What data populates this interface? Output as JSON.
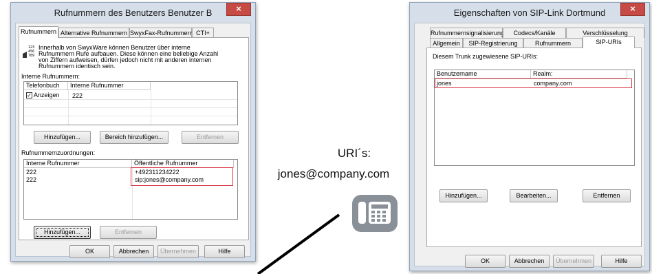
{
  "left_window": {
    "title": "Rufnummern des Benutzers Benutzer B",
    "close_label": "×",
    "tabs": [
      "Rufnummern",
      "Alternative Rufnummern",
      "SwyxFax-Rufnummern",
      "CTI+"
    ],
    "info_lines": [
      "Innerhalb von SwyxWare können Benutzer über interne",
      "Rufnummern Rufe aufbauen. Diese können eine beliebige Anzahl",
      "von Ziffern aufweisen, dürfen jedoch nicht mit anderen internen",
      "Rufnummern identisch sein."
    ],
    "internal_label": "Interne Rufnummern:",
    "internal_columns": [
      "Telefonbuch",
      "Interne Rufnummer"
    ],
    "internal_rows": [
      {
        "phonebook": "Anzeigen",
        "number": "222",
        "checked": true
      }
    ],
    "internal_buttons": {
      "add": "Hinzufügen...",
      "add_range": "Bereich hinzufügen...",
      "remove": "Entfernen"
    },
    "mapping_label": "Rufnummernzuordnungen:",
    "mapping_columns": [
      "Interne Rufnummer",
      "Öffentliche Rufnummer"
    ],
    "mapping_rows": [
      {
        "internal": "222",
        "public": "+492311234222"
      },
      {
        "internal": "222",
        "public": "sip:jones@company.com"
      }
    ],
    "mapping_buttons": {
      "add": "Hinzufügen...",
      "remove": "Entfernen"
    },
    "footer_buttons": {
      "ok": "OK",
      "cancel": "Abbrechen",
      "apply": "Übernehmen",
      "help": "Hilfe"
    }
  },
  "right_window": {
    "title": "Eigenschaften von SIP-Link Dortmund",
    "close_label": "×",
    "tabs_row1": [
      "Rufnummernsignalisierung",
      "Codecs/Kanäle",
      "Verschlüsselung"
    ],
    "tabs_row2": [
      "Allgemein",
      "SIP-Registrierung",
      "Rufnummern",
      "SIP-URIs"
    ],
    "uri_label": "Diesem Trunk zugewiesene SIP-URIs:",
    "columns": [
      "Benutzername",
      "Realm:"
    ],
    "rows": [
      {
        "user": "jones",
        "realm": "company.com"
      }
    ],
    "buttons": {
      "add": "Hinzufügen...",
      "edit": "Bearbeiten...",
      "remove": "Entfernen"
    },
    "footer_buttons": {
      "ok": "OK",
      "cancel": "Abbrechen",
      "apply": "Übernehmen",
      "help": "Hilfe"
    }
  },
  "caption": {
    "line1": "URI´s:",
    "line2": "jones@company.com"
  },
  "colors": {
    "highlight": "#d9394a",
    "close": "#c74b45",
    "frame": "#d6dfe9",
    "phone_icon": "#8a9098"
  },
  "icons": [
    "phone-icon",
    "keypad-icon",
    "close-icon",
    "checkbox-icon"
  ]
}
